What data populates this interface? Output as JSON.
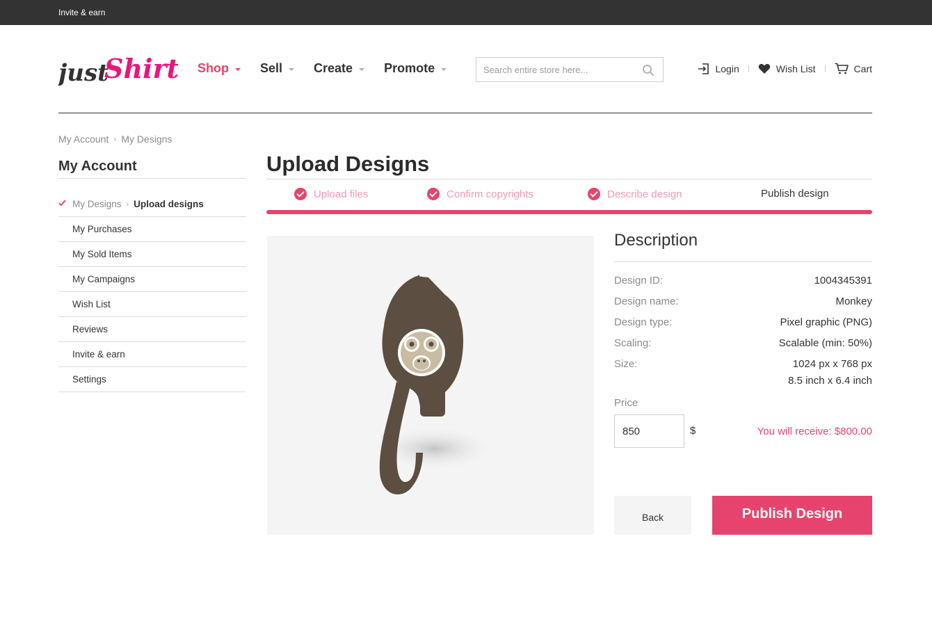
{
  "colors": {
    "accent": "#e6446e",
    "topbar": "#333333",
    "monkey": "#5c4e40",
    "monkey_face": "#c8bca4",
    "preview_bg": "#f4f4f4"
  },
  "topbar": {
    "invite_link": "Invite & earn"
  },
  "logo": {
    "part1": "just",
    "part2": "Shirt"
  },
  "nav": [
    {
      "label": "Shop",
      "active": true
    },
    {
      "label": "Sell",
      "active": false
    },
    {
      "label": "Create",
      "active": false
    },
    {
      "label": "Promote",
      "active": false
    }
  ],
  "search": {
    "placeholder": "Search entire store here...",
    "icon": "search-icon"
  },
  "utilities": {
    "login": "Login",
    "wishlist": "Wish List",
    "cart": "Cart"
  },
  "breadcrumb": [
    "My Account",
    "My Designs"
  ],
  "sidebar": {
    "title": "My Account",
    "items": [
      {
        "label": "My Designs",
        "sublabel": "Upload designs",
        "checked": true
      },
      {
        "label": "My Purchases"
      },
      {
        "label": "My Sold Items"
      },
      {
        "label": "My Campaigns"
      },
      {
        "label": "Wish List"
      },
      {
        "label": "Reviews"
      },
      {
        "label": "Invite & earn"
      },
      {
        "label": "Settings"
      }
    ]
  },
  "main": {
    "title": "Upload Designs",
    "steps": [
      {
        "label": "Upload files",
        "done": true
      },
      {
        "label": "Confirm copyrights",
        "done": true
      },
      {
        "label": "Describe design",
        "done": true
      },
      {
        "label": "Publish design",
        "done": false
      }
    ],
    "progress": 1.0
  },
  "description": {
    "title": "Description",
    "rows": [
      {
        "key": "Design ID:",
        "value": "1004345391"
      },
      {
        "key": "Design name:",
        "value": "Monkey"
      },
      {
        "key": "Design type:",
        "value": "Pixel graphic (PNG)"
      },
      {
        "key": "Scaling:",
        "value": "Scalable (min: 50%)"
      },
      {
        "key": "Size:",
        "value": "1024 px x 768 px",
        "value2": "8.5 inch x 6.4 inch"
      }
    ]
  },
  "price": {
    "label": "Price",
    "value": "850",
    "currency": "$",
    "receive": "You will receive: $800.00"
  },
  "buttons": {
    "back": "Back",
    "publish": "Publish Design"
  }
}
